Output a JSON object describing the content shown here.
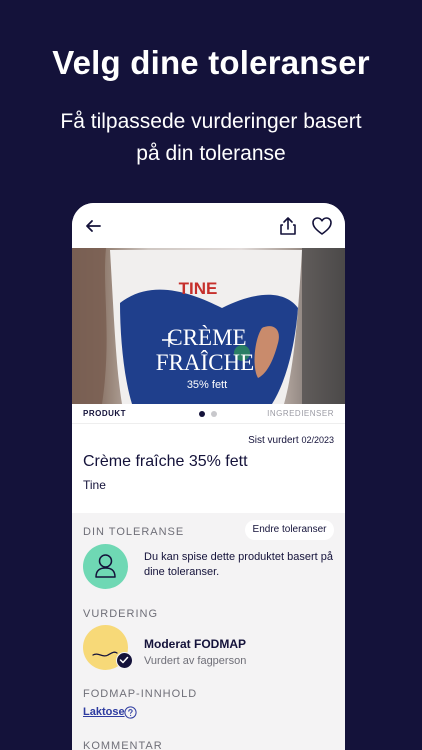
{
  "headline": "Velg dine toleranser",
  "subheadline": "Få tilpassede vurderinger basert på din toleranse",
  "topbar": {
    "back_icon": "arrow-left-icon",
    "share_icon": "share-icon",
    "favorite_icon": "heart-icon"
  },
  "photo": {
    "brand_text": "TINE",
    "product_text_1": "CRÈME",
    "product_text_2": "FRAÎCHE",
    "fat_text": "35% fett"
  },
  "tabs": {
    "product": "PRODUKT",
    "ingredients": "INGREDIENSER",
    "active_index": 0
  },
  "product": {
    "last_rated_label": "Sist vurdert",
    "last_rated_date": "02/2023",
    "name": "Crème fraîche 35% fett",
    "brand": "Tine"
  },
  "tolerance": {
    "title": "DIN TOLERANSE",
    "edit_button": "Endre toleranser",
    "text": "Du kan spise dette produktet basert på dine toleranser."
  },
  "rating": {
    "title": "VURDERING",
    "name": "Moderat FODMAP",
    "subtitle": "Vurdert av fagperson"
  },
  "fodmap": {
    "title": "FODMAP-INNHOLD",
    "item": "Laktose"
  },
  "comment": {
    "title": "KOMMENTAR"
  },
  "colors": {
    "background": "#14123a",
    "tolerance_green": "#6fd8b4",
    "rating_yellow": "#f7d978",
    "link_blue": "#2d3ba0"
  }
}
